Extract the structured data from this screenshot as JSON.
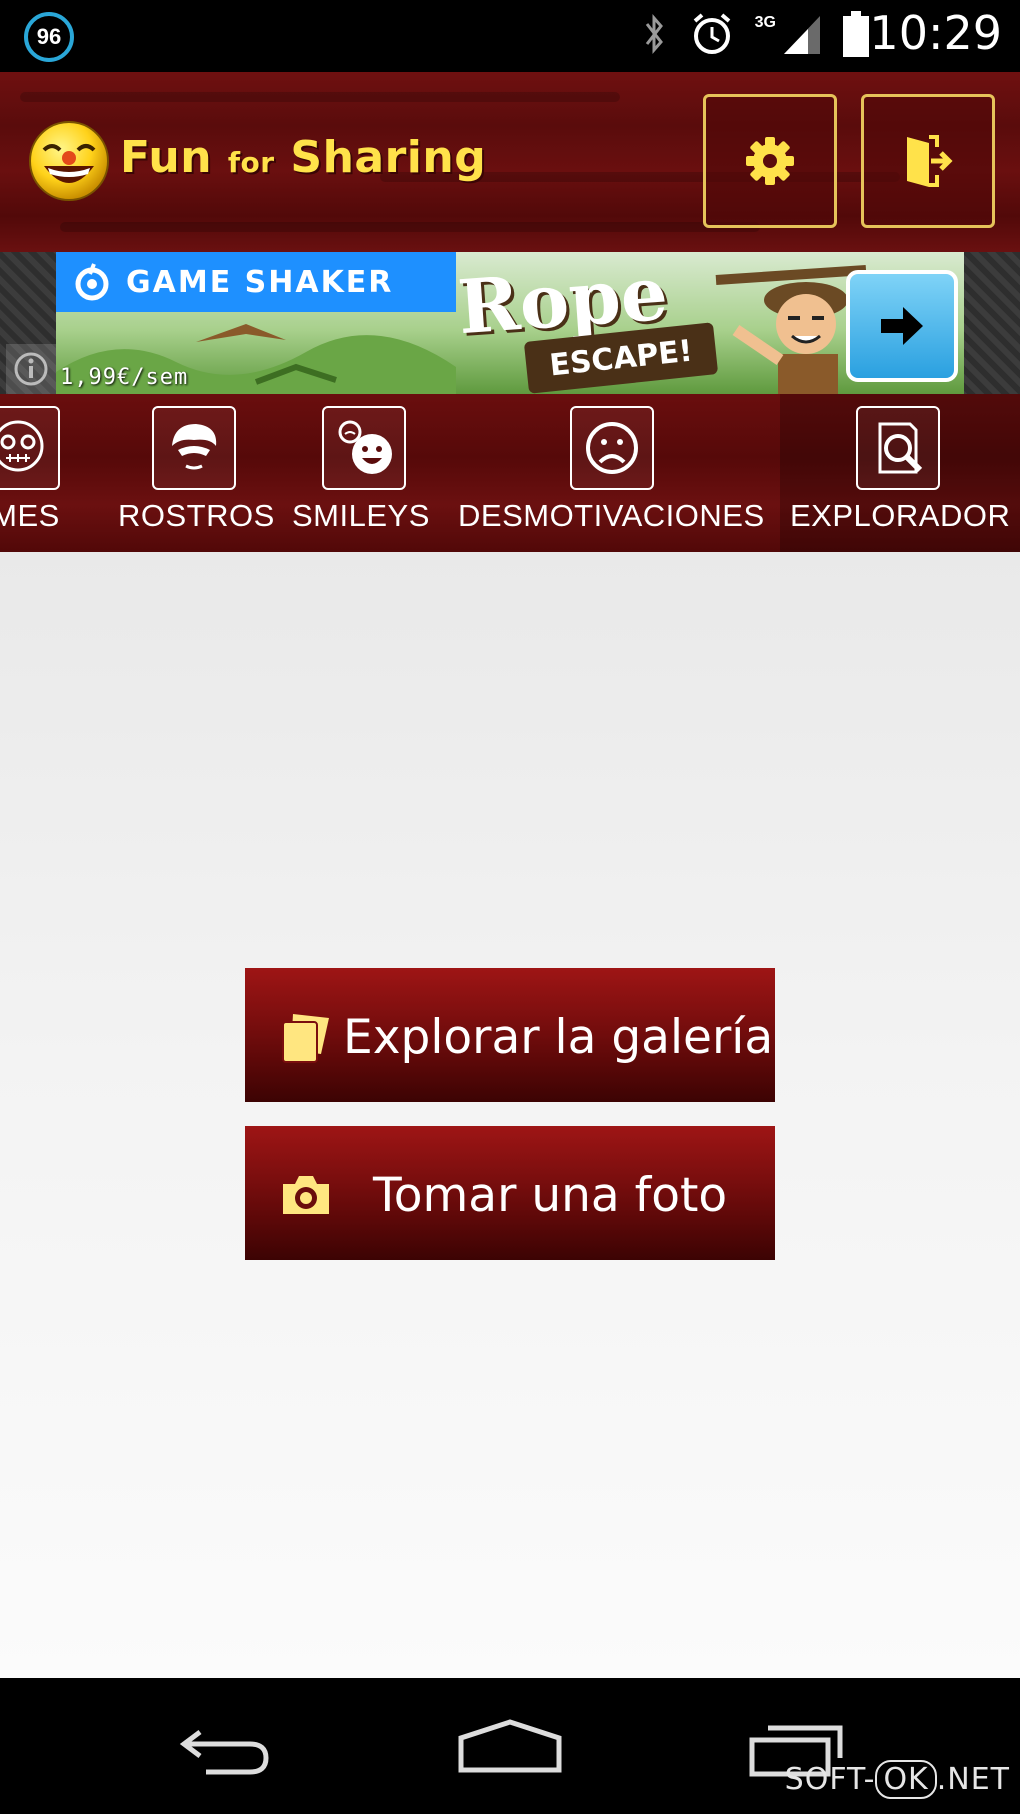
{
  "status_bar": {
    "badge": "96",
    "network": "3G",
    "time": "10:29",
    "icons": [
      "bluetooth-icon",
      "alarm-icon",
      "signal-icon",
      "battery-icon"
    ]
  },
  "app": {
    "title_part1": "Fun",
    "title_part2": "for",
    "title_part3": "Sharing",
    "accent": "#ffe24a",
    "header_color": "#6a0f0f"
  },
  "ad": {
    "brand": "GAME SHAKER",
    "game_title": "Rope",
    "game_subtitle": "ESCAPE!",
    "price": "1,99€/sem"
  },
  "tabs": [
    {
      "label": "EMES",
      "icon": "meme-face-icon",
      "active": false
    },
    {
      "label": "ROSTROS",
      "icon": "face-icon",
      "active": false
    },
    {
      "label": "SMILEYS",
      "icon": "smiley-icon",
      "active": false
    },
    {
      "label": "DESMOTIVACIONES",
      "icon": "sad-face-icon",
      "active": false
    },
    {
      "label": "EXPLORADOR",
      "icon": "explorer-search-icon",
      "active": true
    }
  ],
  "actions": {
    "gallery_label": "Explorar la galería",
    "camera_label": "Tomar una foto"
  },
  "watermark": {
    "part1": "SOFT-",
    "part2": "OK",
    "part3": ".NET"
  }
}
